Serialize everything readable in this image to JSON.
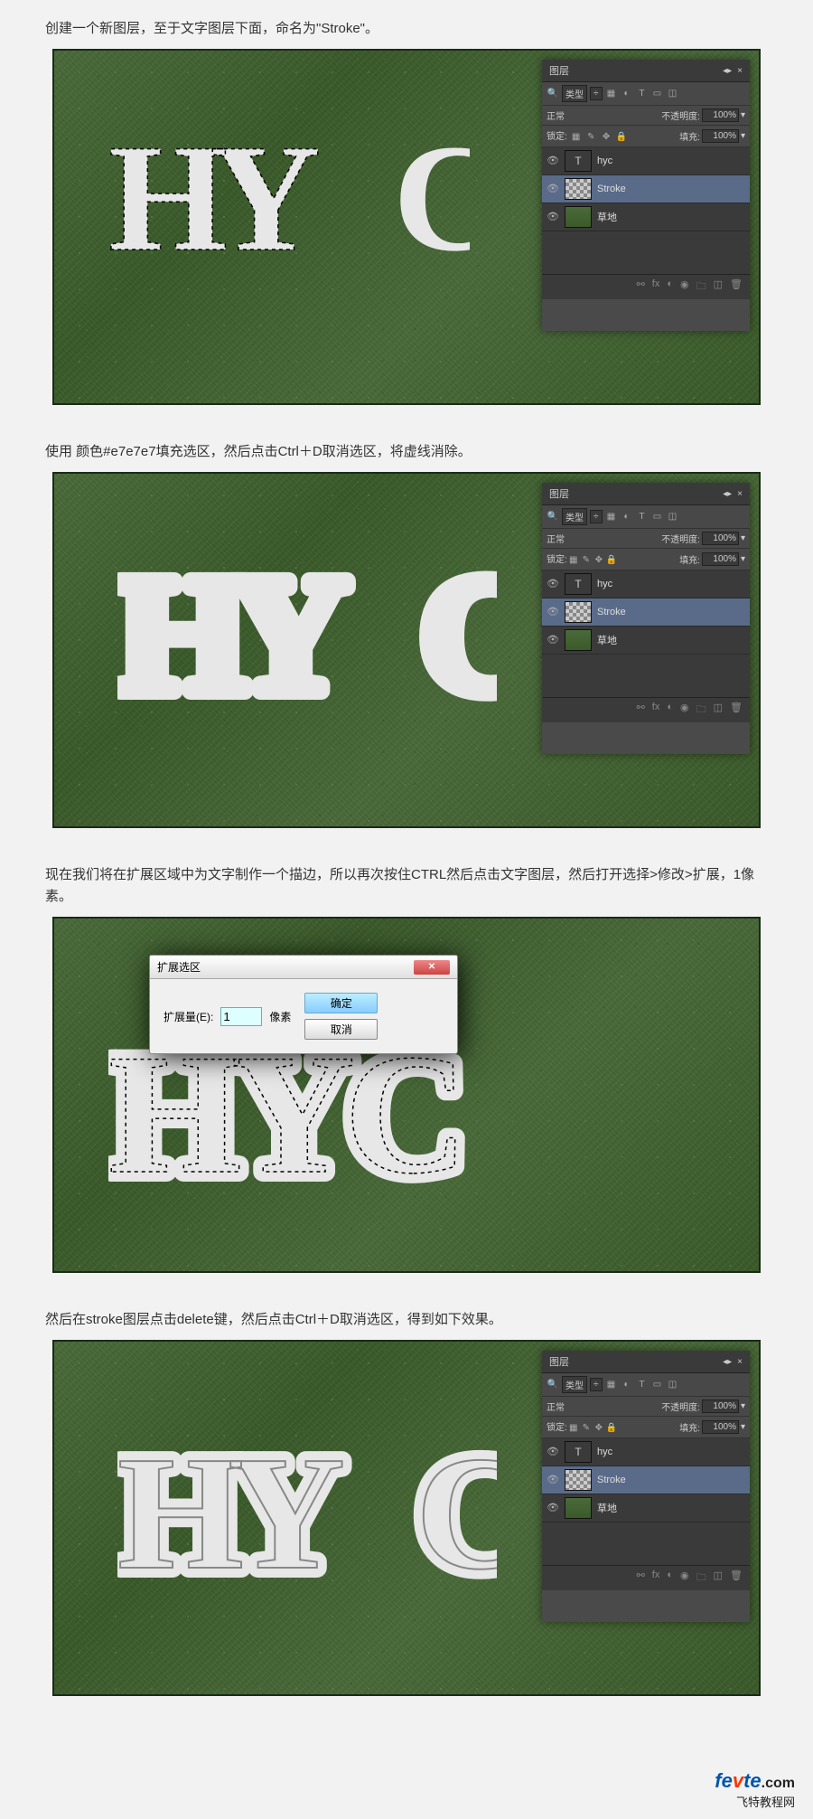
{
  "steps": {
    "s1": "创建一个新图层，至于文字图层下面，命名为\"Stroke\"。",
    "s2": "使用 颜色#e7e7e7填充选区，然后点击Ctrl＋D取消选区，将虚线消除。",
    "s3": "现在我们将在扩展区域中为文字制作一个描边，所以再次按住CTRL然后点击文字图层，然后打开选择>修改>扩展，1像素。",
    "s4": "然后在stroke图层点击delete键，然后点击Ctrl＋D取消选区，得到如下效果。"
  },
  "hyc": "HYC",
  "panel": {
    "title": "图层",
    "filter": "类型",
    "blend": "正常",
    "opacity_label": "不透明度:",
    "fill_label": "填充:",
    "lock_label": "锁定:",
    "opacity_value": "100%",
    "fill_value": "100%",
    "layers": {
      "l1": "hyc",
      "l2": "Stroke",
      "l3": "草地"
    }
  },
  "dialog": {
    "title": "扩展选区",
    "field_label": "扩展量(E):",
    "value": "1",
    "unit": "像素",
    "ok": "确定",
    "cancel": "取消"
  },
  "watermark": {
    "brand1": "fe",
    "brand2": "v",
    "brand3": "te",
    "brand4": ".com",
    "sub": "飞特教程网"
  }
}
